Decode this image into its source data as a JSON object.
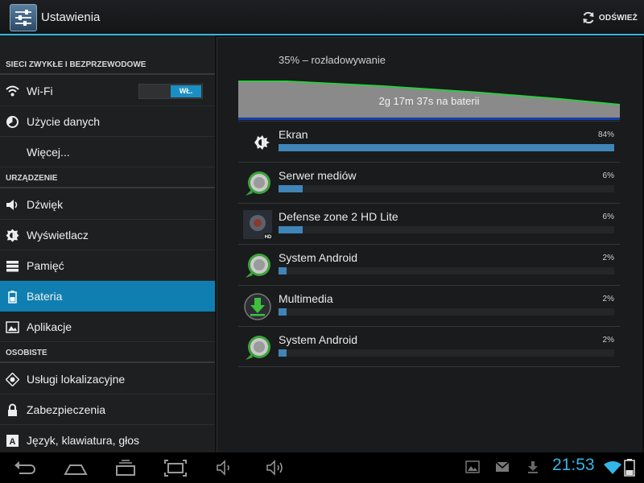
{
  "actionbar": {
    "title": "Ustawienia",
    "refresh_label": "ODŚWIEŻ"
  },
  "sidebar": {
    "sections": [
      {
        "header": "SIECI ZWYKŁE I BEZPRZEWODOWE",
        "items": [
          {
            "label": "Wi-Fi",
            "icon": "wifi-icon",
            "toggle": "WŁ."
          },
          {
            "label": "Użycie danych",
            "icon": "data-usage-icon"
          },
          {
            "label": "Więcej...",
            "icon": ""
          }
        ]
      },
      {
        "header": "URZĄDZENIE",
        "items": [
          {
            "label": "Dźwięk",
            "icon": "sound-icon"
          },
          {
            "label": "Wyświetlacz",
            "icon": "display-icon"
          },
          {
            "label": "Pamięć",
            "icon": "storage-icon"
          },
          {
            "label": "Bateria",
            "icon": "battery-icon",
            "selected": true
          },
          {
            "label": "Aplikacje",
            "icon": "apps-icon"
          }
        ]
      },
      {
        "header": "OSOBISTE",
        "items": [
          {
            "label": "Usługi lokalizacyjne",
            "icon": "location-icon"
          },
          {
            "label": "Zabezpieczenia",
            "icon": "lock-icon"
          },
          {
            "label": "Język, klawiatura, głos",
            "icon": "language-icon"
          }
        ]
      }
    ]
  },
  "battery": {
    "status": "35% – rozładowywanie",
    "time_on_battery": "2g 17m 37s na baterii",
    "usage": [
      {
        "name": "Ekran",
        "percent": "84%",
        "value": 84,
        "icon": "brightness-icon"
      },
      {
        "name": "Serwer mediów",
        "percent": "6%",
        "value": 6,
        "icon": "android-system-icon"
      },
      {
        "name": "Defense zone 2 HD Lite",
        "percent": "6%",
        "value": 6,
        "icon": "game-app-icon"
      },
      {
        "name": "System Android",
        "percent": "2%",
        "value": 2,
        "icon": "android-system-icon"
      },
      {
        "name": "Multimedia",
        "percent": "2%",
        "value": 2,
        "icon": "download-icon"
      },
      {
        "name": "System Android",
        "percent": "2%",
        "value": 2,
        "icon": "android-system-icon"
      }
    ]
  },
  "navbar": {
    "clock": "21:53",
    "buttons": [
      "back-icon",
      "home-icon",
      "recent-apps-icon",
      "screenshot-icon",
      "volume-down-icon",
      "volume-up-icon"
    ],
    "notifications": [
      "gallery-icon",
      "gmail-icon",
      "download-notification-icon",
      "wifi-signal-icon",
      "battery-status-icon"
    ]
  },
  "colors": {
    "accent": "#33b5e5",
    "selected_item": "#0e7fb0",
    "usage_bar": "#4085b8",
    "graph_line": "#2ecc40"
  }
}
